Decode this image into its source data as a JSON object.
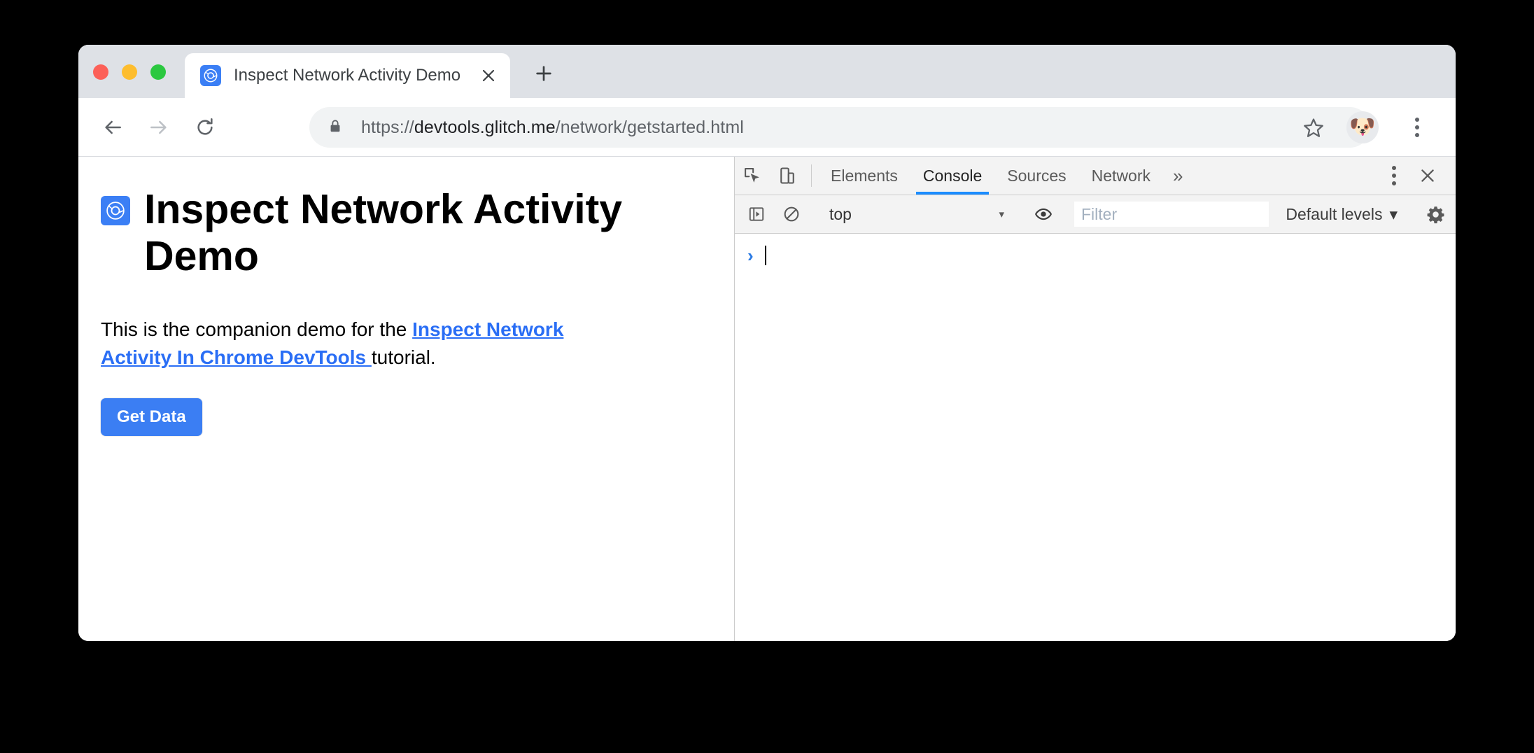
{
  "browser": {
    "traffic_lights": [
      {
        "name": "close",
        "color": "#fc6058"
      },
      {
        "name": "minimize",
        "color": "#fdbd2e"
      },
      {
        "name": "maximize",
        "color": "#2bc840"
      }
    ],
    "tab": {
      "title": "Inspect Network Activity Demo",
      "favicon": "chrome-devtools-icon",
      "close_label": "×"
    },
    "new_tab_label": "+",
    "nav": {
      "back_icon": "back-arrow-icon",
      "forward_icon": "forward-arrow-icon",
      "reload_icon": "reload-icon",
      "lock_icon": "lock-icon",
      "url_scheme": "https://",
      "url_host": "devtools.glitch.me",
      "url_path": "/network/getstarted.html",
      "star_icon": "star-icon",
      "avatar_icon": "🐶",
      "menu_icon": "three-dot-menu-icon"
    }
  },
  "page": {
    "heading": "Inspect Network Activity Demo",
    "paragraph_before": "This is the companion demo for the ",
    "link_text": "Inspect Network Activity In Chrome DevTools ",
    "paragraph_after": "tutorial.",
    "button_label": "Get Data",
    "accent_color": "#3b7ef3",
    "link_color": "#2a6ef5"
  },
  "devtools": {
    "inspect_icon": "inspect-element-icon",
    "device_icon": "device-toolbar-icon",
    "tabs": [
      {
        "label": "Elements",
        "active": false
      },
      {
        "label": "Console",
        "active": true
      },
      {
        "label": "Sources",
        "active": false
      },
      {
        "label": "Network",
        "active": false
      }
    ],
    "more_tabs_label": "»",
    "more_options_icon": "vertical-dots-icon",
    "close_label": "×",
    "active_tab_color": "#1a8cff",
    "console_toolbar": {
      "sidebar_icon": "console-sidebar-icon",
      "clear_icon": "clear-console-icon",
      "context_value": "top",
      "context_caret": "▾",
      "eye_icon": "live-expression-eye-icon",
      "filter_placeholder": "Filter",
      "filter_value": "",
      "levels_label": "Default levels",
      "levels_caret": "▾",
      "settings_icon": "gear-icon"
    },
    "console": {
      "prompt": "›",
      "input_value": ""
    }
  }
}
